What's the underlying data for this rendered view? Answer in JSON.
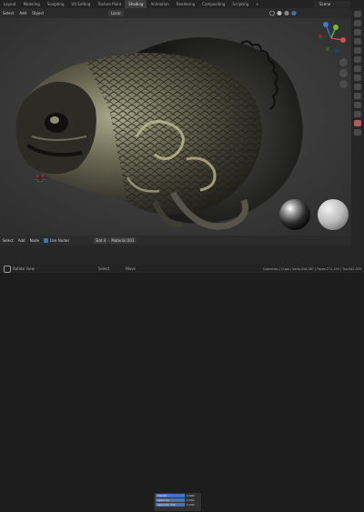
{
  "topbar": {
    "tabs": [
      "Layout",
      "Modeling",
      "Sculpting",
      "UV Editing",
      "Texture Paint",
      "Shading",
      "Animation",
      "Rendering",
      "Compositing",
      "Scripting"
    ],
    "active_tab": "Shading",
    "add_tab": "+",
    "scene": "Scene"
  },
  "viewport_header": {
    "mode": "Select",
    "menus": [
      "Add",
      "Object"
    ],
    "transform": "Local"
  },
  "node_editor_header": {
    "items": [
      "Select",
      "Add",
      "Node"
    ],
    "use_nodes_label": "Use Nodes",
    "slot": "Slot 4",
    "material": "Material.003"
  },
  "overlay_panel": {
    "rows": [
      {
        "label": "Metallic",
        "value": "0.000"
      },
      {
        "label": "Specular",
        "value": "0.500"
      },
      {
        "label": "Specular Tint",
        "value": "0.000"
      }
    ]
  },
  "status_bar": {
    "left": "Rotate View",
    "mid1": "Select",
    "mid2": "Move",
    "right": "Collection | Cube | Verts:256,387 | Faces:271,195 | Tris:541,378"
  },
  "colors": {
    "accent": "#4772b3",
    "x_axis": "#e04a4a",
    "y_axis": "#72b83a",
    "z_axis": "#3a7bd5"
  }
}
